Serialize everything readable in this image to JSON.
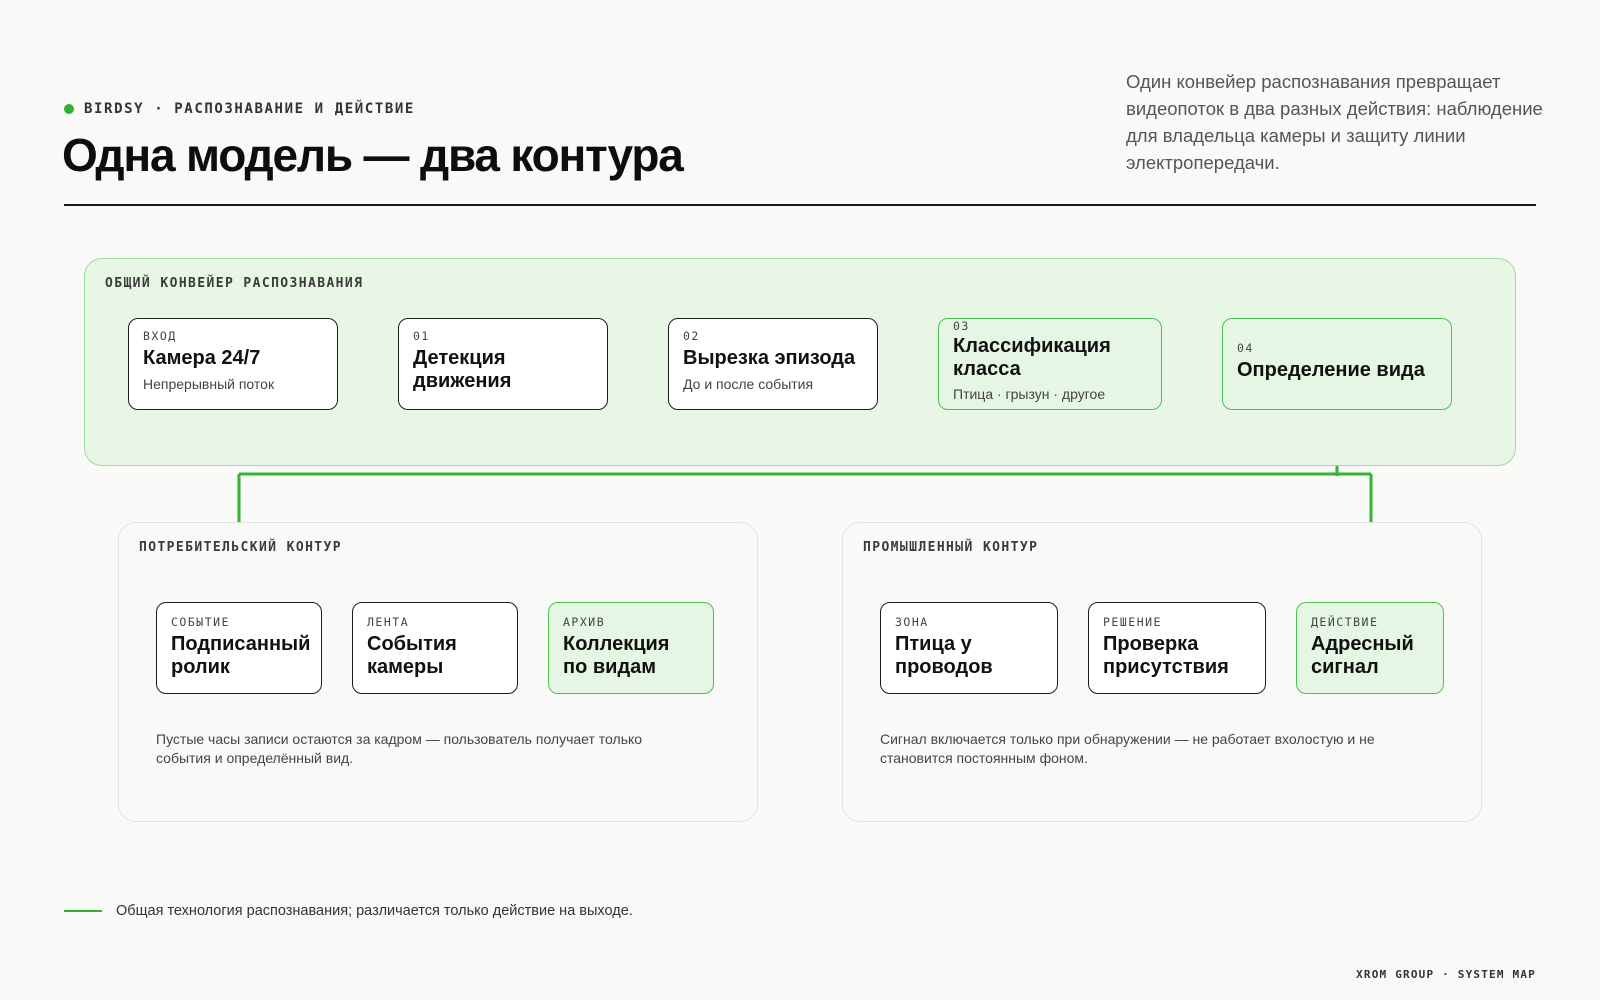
{
  "header": {
    "eyebrow": "BIRDSY · РАСПОЗНАВАНИЕ И ДЕЙСТВИЕ",
    "title": "Одна модель — два контура",
    "intro": "Один конвейер распознавания превращает видеопоток в два разных действия: наблюдение для владельца камеры и защиту линии электропередачи."
  },
  "pipeline": {
    "label": "ОБЩИЙ КОНВЕЙЕР РАСПОЗНАВАНИЯ",
    "nodes": [
      {
        "tag": "ВХОД",
        "name": "Камера 24/7",
        "sub": "Непрерывный поток"
      },
      {
        "tag": "01",
        "name": "Детекция движения",
        "sub": ""
      },
      {
        "tag": "02",
        "name": "Вырезка эпизода",
        "sub": "До и после события"
      },
      {
        "tag": "03",
        "name": "Классификация класса",
        "sub": "Птица · грызун · другое"
      },
      {
        "tag": "04",
        "name": "Определение вида",
        "sub": ""
      }
    ]
  },
  "consumer": {
    "label": "ПОТРЕБИТЕЛЬСКИЙ КОНТУР",
    "nodes": [
      {
        "tag": "СОБЫТИЕ",
        "name": "Подписанный ролик"
      },
      {
        "tag": "ЛЕНТА",
        "name": "События камеры"
      },
      {
        "tag": "АРХИВ",
        "name": "Коллекция по видам"
      }
    ],
    "note": "Пустые часы записи остаются за кадром — пользователь получает только события и определённый вид."
  },
  "industrial": {
    "label": "ПРОМЫШЛЕННЫЙ КОНТУР",
    "nodes": [
      {
        "tag": "ЗОНА",
        "name": "Птица у проводов"
      },
      {
        "tag": "РЕШЕНИЕ",
        "name": "Проверка присутствия"
      },
      {
        "tag": "ДЕЙСТВИЕ",
        "name": "Адресный сигнал"
      }
    ],
    "note": "Сигнал включается только при обнаружении — не работает вхолостую и не становится постоянным фоном."
  },
  "legend": "Общая технология распознавания; различается только действие на выходе.",
  "footer": "XROM GROUP · SYSTEM MAP",
  "colors": {
    "accent": "#2fb02f",
    "panel_green": "#e8f6e6",
    "background": "#f9f9f7"
  }
}
